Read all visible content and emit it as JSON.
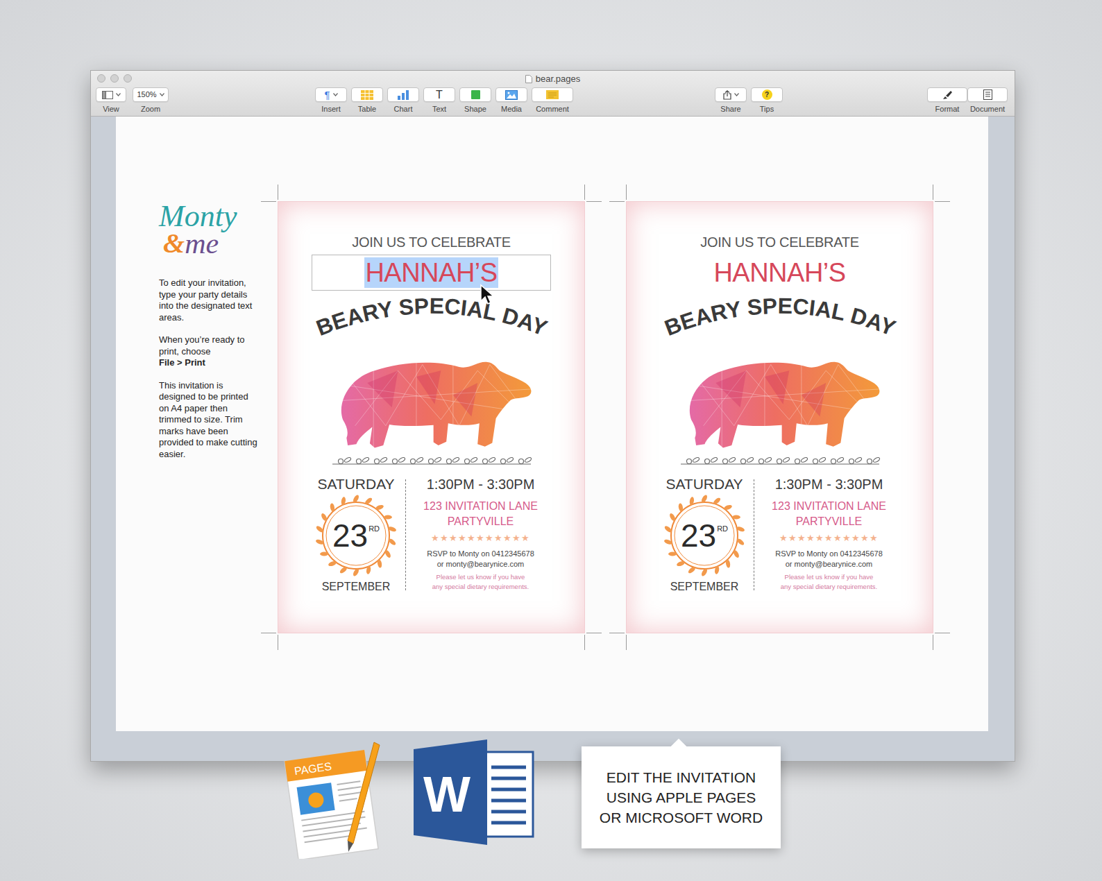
{
  "window": {
    "title": "bear.pages"
  },
  "toolbar": {
    "left": [
      {
        "kind": "view",
        "label": "View"
      },
      {
        "kind": "zoom",
        "label": "Zoom",
        "value": "150%"
      }
    ],
    "center": [
      {
        "kind": "insert",
        "label": "Insert",
        "glyph": "¶"
      },
      {
        "kind": "table",
        "label": "Table"
      },
      {
        "kind": "chart",
        "label": "Chart"
      },
      {
        "kind": "text",
        "label": "Text",
        "glyph": "T"
      },
      {
        "kind": "shape",
        "label": "Shape"
      },
      {
        "kind": "media",
        "label": "Media"
      },
      {
        "kind": "comment",
        "label": "Comment"
      }
    ],
    "share": [
      {
        "kind": "share",
        "label": "Share"
      },
      {
        "kind": "tips",
        "label": "Tips",
        "glyph": "?"
      }
    ],
    "right": [
      {
        "kind": "format",
        "label": "Format"
      },
      {
        "kind": "document",
        "label": "Document"
      }
    ]
  },
  "sidebar": {
    "logo": {
      "first": "Monty",
      "amp": "&",
      "last": "me"
    },
    "paragraphs": [
      [
        {
          "text": "To edit your invitation, type your party details into the designated text areas.",
          "bold": false
        }
      ],
      [
        {
          "text": "When you’re ready to print, choose",
          "bold": false
        },
        {
          "text": "File > Print",
          "bold": true
        }
      ],
      [
        {
          "text": "This invitation is designed to be printed on A4 paper then trimmed to size. Trim marks have been provided to make cutting easier.",
          "bold": false
        }
      ]
    ]
  },
  "invitation": {
    "intro": "JOIN US TO CELEBRATE",
    "name": "HANNAH’S",
    "headline": "BEARY SPECIAL DAY",
    "day": "SATURDAY",
    "date": "23",
    "suffix": "RD",
    "month": "SEPTEMBER",
    "time": "1:30PM - 3:30PM",
    "address": [
      "123 INVITATION LANE",
      "PARTYVILLE"
    ],
    "stars": "★★★★★★★★★★★",
    "rsvp": [
      "RSVP to Monty on 0412345678",
      "or monty@bearynice.com"
    ],
    "note": [
      "Please let us know if you have",
      "any special dietary requirements."
    ]
  },
  "copies": [
    {
      "editing": true
    },
    {
      "editing": false
    }
  ],
  "apps": [
    {
      "kind": "pages",
      "label": "PAGES"
    },
    {
      "kind": "word",
      "label": "W"
    }
  ],
  "callout": {
    "lines": [
      "EDIT THE INVITATION",
      "USING APPLE PAGES",
      "OR MICROSOFT WORD"
    ]
  }
}
